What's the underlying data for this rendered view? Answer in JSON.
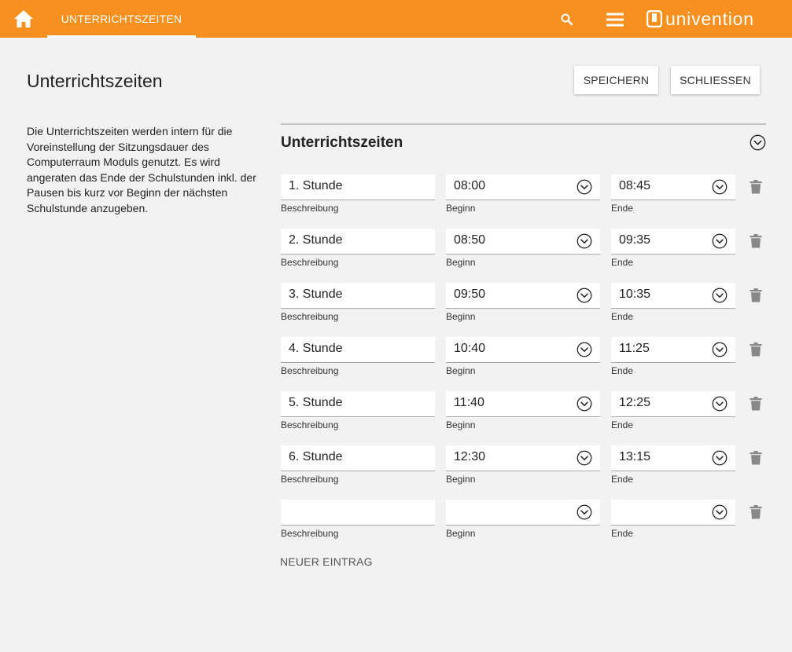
{
  "header": {
    "tab_label": "UNTERRICHTSZEITEN",
    "logo_text": "univention",
    "home_icon": "home-icon",
    "search_icon": "search-icon",
    "menu_icon": "hamburger-menu-icon",
    "accent_color": "#f7901e"
  },
  "page": {
    "title": "Unterrichtszeiten",
    "save_label": "SPEICHERN",
    "close_label": "SCHLIESSEN",
    "description": "Die Unterrichtszeiten werden intern für die Voreinstellung der Sitzungsdauer des Computerraum Moduls genutzt. Es wird angeraten das Ende der Schulstunden inkl. der Pausen bis kurz vor Beginn der nächsten Schulstunde anzugeben."
  },
  "section": {
    "title": "Unterrichtszeiten",
    "collapse_icon": "chevron-down-circle-icon",
    "new_entry_label": "NEUER EINTRAG"
  },
  "rows": [
    {
      "description": "1. Stunde",
      "start": "08:00",
      "end": "08:45",
      "description_label": "Beschreibung",
      "start_label": "Beginn",
      "end_label": "Ende"
    },
    {
      "description": "2. Stunde",
      "start": "08:50",
      "end": "09:35",
      "description_label": "Beschreibung",
      "start_label": "Beginn",
      "end_label": "Ende"
    },
    {
      "description": "3. Stunde",
      "start": "09:50",
      "end": "10:35",
      "description_label": "Beschreibung",
      "start_label": "Beginn",
      "end_label": "Ende"
    },
    {
      "description": "4. Stunde",
      "start": "10:40",
      "end": "11:25",
      "description_label": "Beschreibung",
      "start_label": "Beginn",
      "end_label": "Ende"
    },
    {
      "description": "5. Stunde",
      "start": "11:40",
      "end": "12:25",
      "description_label": "Beschreibung",
      "start_label": "Beginn",
      "end_label": "Ende"
    },
    {
      "description": "6. Stunde",
      "start": "12:30",
      "end": "13:15",
      "description_label": "Beschreibung",
      "start_label": "Beginn",
      "end_label": "Ende"
    },
    {
      "description": "",
      "start": "",
      "end": "",
      "description_label": "Beschreibung",
      "start_label": "Beginn",
      "end_label": "Ende"
    }
  ]
}
